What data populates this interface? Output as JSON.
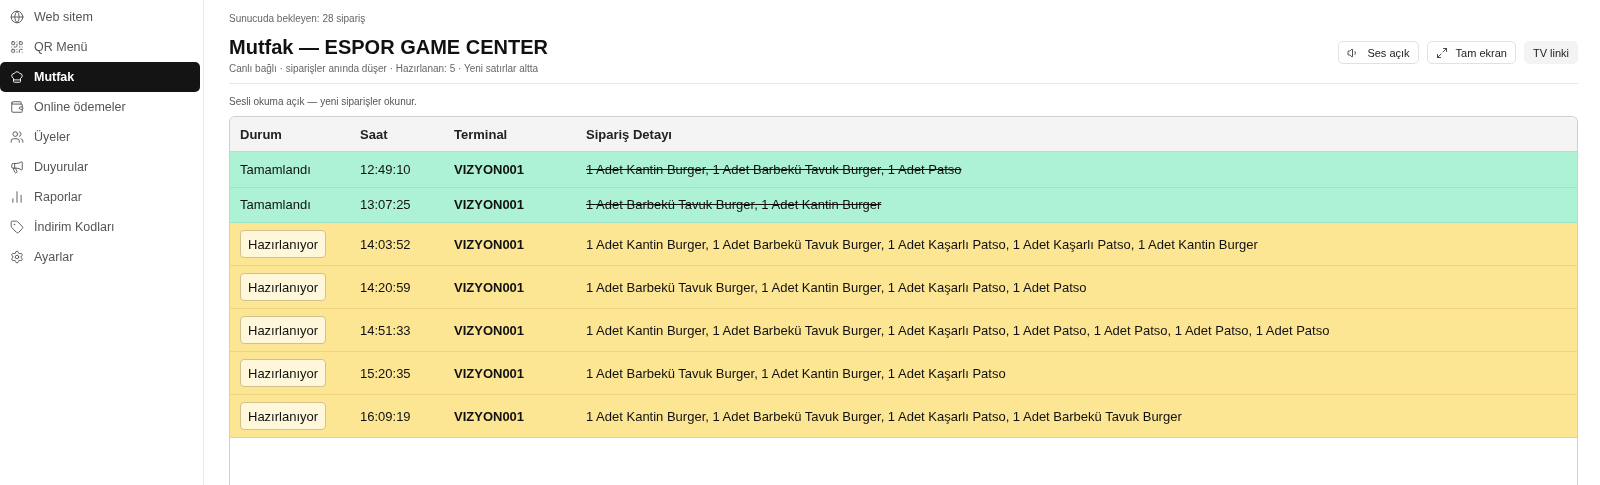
{
  "sidebar": {
    "items": [
      {
        "label": "Web sitem",
        "selected": false
      },
      {
        "label": "QR Menü",
        "selected": false
      },
      {
        "label": "Mutfak",
        "selected": true
      },
      {
        "label": "Online ödemeler",
        "selected": false
      },
      {
        "label": "Üyeler",
        "selected": false
      },
      {
        "label": "Duyurular",
        "selected": false
      },
      {
        "label": "Raporlar",
        "selected": false
      },
      {
        "label": "İndirim Kodları",
        "selected": false
      },
      {
        "label": "Ayarlar",
        "selected": false
      }
    ]
  },
  "header": {
    "pending": "Sunucuda bekleyen: 28 sipariş",
    "title": "Mutfak — ESPOR GAME CENTER",
    "subtitle": "Canlı bağlı · siparişler anında düşer · Hazırlanan: 5 · Yeni satırlar altta",
    "buttons": [
      {
        "label": "Ses açık",
        "kind": "sound"
      },
      {
        "label": "Tam ekran",
        "kind": "fullscreen"
      },
      {
        "label": "TV linki",
        "kind": "plain"
      }
    ]
  },
  "notice": "Sesli okuma açık — yeni siparişler okunur.",
  "table": {
    "columns": [
      "Durum",
      "Saat",
      "Terminal",
      "Sipariş Detayı"
    ],
    "rows": [
      {
        "kind": "done",
        "status": "Tamamlandı",
        "time": "12:49:10",
        "terminal": "VIZYON001",
        "detail": "1 Adet Kantin Burger, 1 Adet Barbekü Tavuk Burger, 1 Adet Patso"
      },
      {
        "kind": "done",
        "status": "Tamamlandı",
        "time": "13:07:25",
        "terminal": "VIZYON001",
        "detail": "1 Adet Barbekü Tavuk Burger, 1 Adet Kantin Burger"
      },
      {
        "kind": "preparing",
        "status": "Hazırlanıyor",
        "time": "14:03:52",
        "terminal": "VIZYON001",
        "detail": "1 Adet Kantin Burger, 1 Adet Barbekü Tavuk Burger, 1 Adet Kaşarlı Patso, 1 Adet Kaşarlı Patso, 1 Adet Kantin Burger"
      },
      {
        "kind": "preparing",
        "status": "Hazırlanıyor",
        "time": "14:20:59",
        "terminal": "VIZYON001",
        "detail": "1 Adet Barbekü Tavuk Burger, 1 Adet Kantin Burger, 1 Adet Kaşarlı Patso, 1 Adet Patso"
      },
      {
        "kind": "preparing",
        "status": "Hazırlanıyor",
        "time": "14:51:33",
        "terminal": "VIZYON001",
        "detail": "1 Adet Kantin Burger, 1 Adet Barbekü Tavuk Burger, 1 Adet Kaşarlı Patso, 1 Adet Patso, 1 Adet Patso, 1 Adet Patso, 1 Adet Patso"
      },
      {
        "kind": "preparing",
        "status": "Hazırlanıyor",
        "time": "15:20:35",
        "terminal": "VIZYON001",
        "detail": "1 Adet Barbekü Tavuk Burger, 1 Adet Kantin Burger, 1 Adet Kaşarlı Patso"
      },
      {
        "kind": "preparing",
        "status": "Hazırlanıyor",
        "time": "16:09:19",
        "terminal": "VIZYON001",
        "detail": "1 Adet Kantin Burger, 1 Adet Barbekü Tavuk Burger, 1 Adet Kaşarlı Patso, 1 Adet Barbekü Tavuk Burger"
      }
    ]
  }
}
